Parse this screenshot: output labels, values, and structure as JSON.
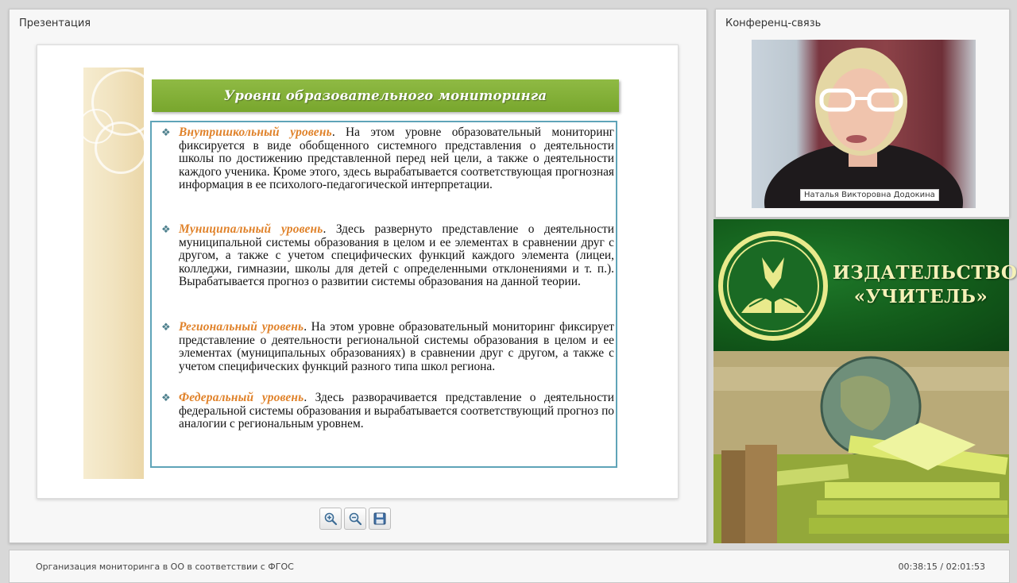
{
  "presentation_panel": {
    "title": "Презентация"
  },
  "conference_panel": {
    "title": "Конференц-связь",
    "speaker_name": "Наталья Викторовна Додокина"
  },
  "slide": {
    "title": "Уровни образовательного мониторинга",
    "items": [
      {
        "term": "Внутришкольный уровень",
        "text": ". На этом уровне образовательный мониторинг фиксируется в виде обобщенного системного представления о деятельности школы по достижению представленной перед ней цели, а также о деятельности каждого ученика. Кроме этого, здесь вырабатывается соответствующая прогнозная информация в ее психолого-педагогической интерпретации."
      },
      {
        "term": "Муниципальный уровень",
        "text": ". Здесь развернуто представление о деятельности муниципальной системы образования в целом и ее элементах в сравнении друг с другом, а также с учетом специфических функций каждого элемента (лицеи, колледжи, гимназии, школы для детей с определенными отклонениями и т. п.). Вырабатывается прогноз о развитии системы образования на данной теории."
      },
      {
        "term": "Региональный уровень",
        "text": ". На этом уровне образовательный мониторинг фиксирует представление о деятельности региональной системы образования в целом и ее элементах (муниципальных образованиях) в сравнении друг с другом, а также с учетом специфических функций разного типа школ региона."
      },
      {
        "term": "Федеральный уровень",
        "text": ". Здесь разворачивается представление о деятельности федеральной системы образования и вырабатывается соответствующий прогноз по аналогии с региональным уровнем."
      }
    ]
  },
  "toolbar": {
    "buttons": [
      {
        "icon": "zoom-in-icon"
      },
      {
        "icon": "zoom-out-icon"
      },
      {
        "icon": "save-icon"
      }
    ]
  },
  "publisher": {
    "line1": "ИЗДАТЕЛЬСТВО",
    "line2": "«УЧИТЕЛЬ»"
  },
  "footer": {
    "lecture_title": "Организация мониторинга в ОО в соответствии с ФГОС",
    "time": "00:38:15 / 02:01:53"
  },
  "colors": {
    "accent_green": "#7aa82f",
    "term_orange": "#e0822a",
    "box_border": "#5fa4b8",
    "brand_green": "#135c1b"
  }
}
